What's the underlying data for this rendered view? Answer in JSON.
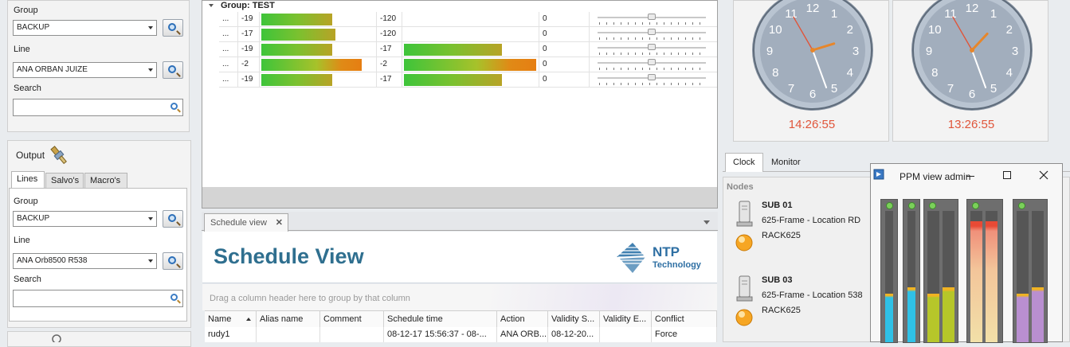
{
  "input_panel": {
    "group_label": "Group",
    "group_value": "BACKUP",
    "line_label": "Line",
    "line_value": "ANA ORBAN JUIZE",
    "search_label": "Search",
    "search_value": ""
  },
  "output_panel": {
    "title": "Output",
    "tabs": [
      {
        "label": "Lines"
      },
      {
        "label": "Salvo's"
      },
      {
        "label": "Macro's"
      }
    ],
    "group_label": "Group",
    "group_value": "BACKUP",
    "line_label": "Line",
    "line_value": "ANA Orb8500 R538",
    "search_label": "Search",
    "search_value": ""
  },
  "level_grid": {
    "group_header": "Group: TEST",
    "rows": [
      {
        "dots": "...",
        "level_left": "-19",
        "bar_left": 0.62,
        "level_right": "-120",
        "bar_right": 0.0,
        "value": "0",
        "slider": 0.5
      },
      {
        "dots": "...",
        "level_left": "-17",
        "bar_left": 0.65,
        "level_right": "-120",
        "bar_right": 0.0,
        "value": "0",
        "slider": 0.5
      },
      {
        "dots": "...",
        "level_left": "-19",
        "bar_left": 0.62,
        "level_right": "-17",
        "bar_right": 0.73,
        "value": "0",
        "slider": 0.5
      },
      {
        "dots": "...",
        "level_left": "-2",
        "bar_left": 0.88,
        "level_right": "-2",
        "bar_right": 0.99,
        "value": "0",
        "slider": 0.5
      },
      {
        "dots": "...",
        "level_left": "-19",
        "bar_left": 0.62,
        "level_right": "-17",
        "bar_right": 0.73,
        "value": "0",
        "slider": 0.5
      }
    ]
  },
  "schedule": {
    "tab_label": "Schedule view",
    "close_glyph": "✕",
    "title": "Schedule View",
    "logo_text_1": "NTP",
    "logo_text_2": "Technology",
    "group_hint": "Drag a column header here to group by that column",
    "columns": [
      "Name",
      "Alias name",
      "Comment",
      "Schedule time",
      "Action",
      "Validity S...",
      "Validity E...",
      "Conflict"
    ],
    "rows": [
      [
        "rudy1",
        "",
        "",
        "08-12-17 15:56:37 - 08-...",
        "ANA ORB...",
        "08-12-20...",
        "",
        "Force"
      ]
    ]
  },
  "clocks": [
    {
      "time": "14:26:55",
      "hour_hand_deg": 73,
      "minute_hand_deg": 160,
      "second_hand_deg": 330
    },
    {
      "time": "13:26:55",
      "hour_hand_deg": 43,
      "minute_hand_deg": 160,
      "second_hand_deg": 330
    }
  ],
  "clock_tabs": [
    {
      "label": "Clock"
    },
    {
      "label": "Monitor"
    }
  ],
  "nodes": {
    "title": "Nodes",
    "items": [
      {
        "name": "SUB 01",
        "desc": "625-Frame - Location RD",
        "rack": "RACK625"
      },
      {
        "name": "SUB 03",
        "desc": "625-Frame - Location 538",
        "rack": "RACK625"
      }
    ]
  },
  "ppm_window": {
    "title": "PPM view admin",
    "meters": [
      {
        "color": "#2fc1e6",
        "levels": [
          0.37,
          0.42
        ]
      },
      {
        "color": "#b6c62a",
        "levels": [
          0.37,
          0.42
        ]
      },
      {
        "color": "#e85b3f",
        "levels": [
          0.92,
          0.92
        ]
      },
      {
        "color": "#b98fd0",
        "levels": [
          0.37,
          0.42
        ]
      }
    ]
  }
}
